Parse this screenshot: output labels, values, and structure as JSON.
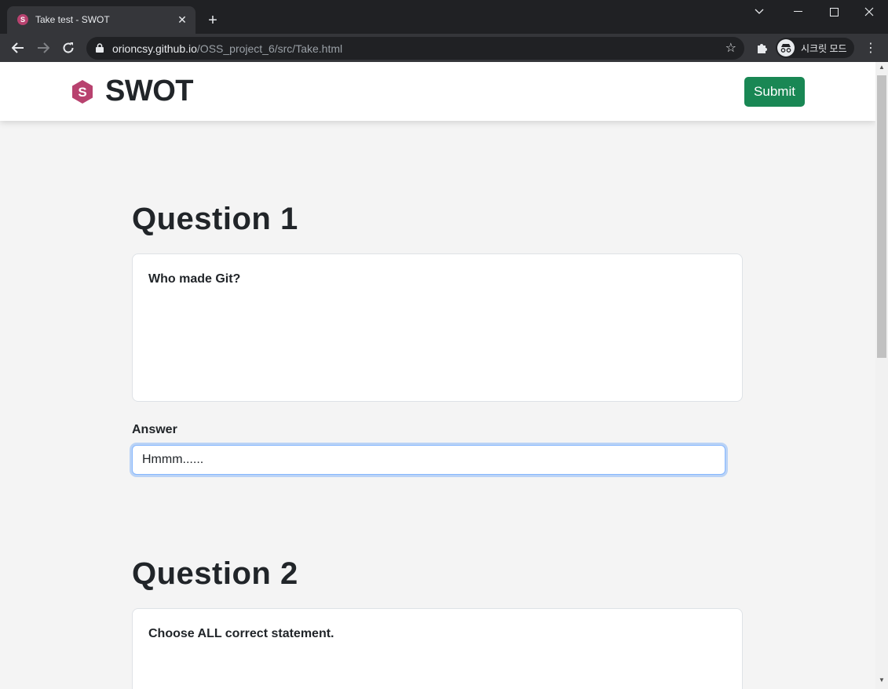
{
  "browser": {
    "tab_title": "Take test - SWOT",
    "tab_favicon_letter": "S",
    "url_host": "orioncsy.github.io",
    "url_path": "/OSS_project_6/src/Take.html",
    "profile_label": "시크릿 모드"
  },
  "navbar": {
    "brand": "SWOT",
    "submit_label": "Submit"
  },
  "questions": [
    {
      "title": "Question 1",
      "text": "Who made Git?",
      "answer_label": "Answer",
      "answer_value": "Hmmm......"
    },
    {
      "title": "Question 2",
      "text": "Choose ALL correct statement."
    }
  ],
  "colors": {
    "brand_logo": "#b8426f",
    "submit_bg": "#198754",
    "focus_ring": "#86b7fe"
  }
}
